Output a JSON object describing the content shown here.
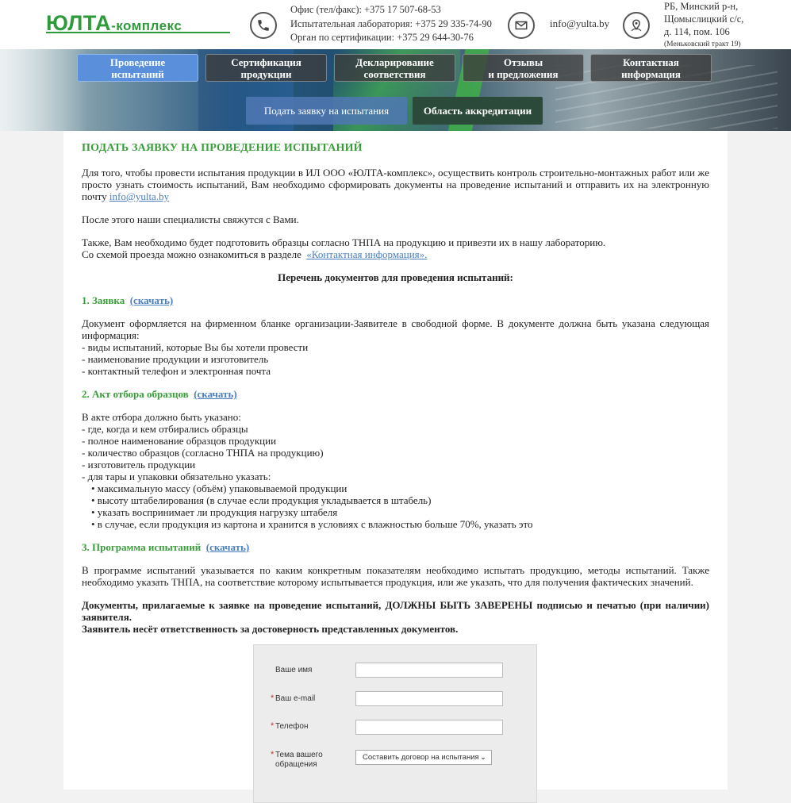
{
  "header": {
    "logo_main": "ЮЛТА",
    "logo_sub": "-комплекс",
    "phones": [
      "Офис (тел/факс): +375 17 507-68-53",
      "Испытательная лаборатория: +375 29 335-74-90",
      "Орган по сертификации: +375 29 644-30-76"
    ],
    "email": "info@yulta.by",
    "address": [
      "РБ, Минский р-н,",
      "Щомыслицкий с/с,",
      "д. 114, пом. 106"
    ],
    "address_note": "(Меньковский тракт 19)"
  },
  "nav": {
    "items": [
      {
        "label": "Проведение\nиспытаний",
        "active": true
      },
      {
        "label": "Сертификация\nпродукции",
        "active": false
      },
      {
        "label": "Декларирование\nсоответствия",
        "active": false
      },
      {
        "label": "Отзывы\nи предложения",
        "active": false
      },
      {
        "label": "Контактная\nинформация",
        "active": false
      }
    ],
    "sub_request": "Подать заявку на испытания",
    "sub_accreditation": "Область аккредитации"
  },
  "page": {
    "title": "ПОДАТЬ ЗАЯВКУ НА ПРОВЕДЕНИЕ ИСПЫТАНИЙ",
    "intro": "Для того, чтобы провести испытания продукции в ИЛ ООО «ЮЛТА-комплекс», осуществить контроль строительно-монтажных работ или же просто узнать стоимость испытаний, Вам необходимо сформировать документы на проведение испытаний и отправить их на электронную почту",
    "intro_email": "info@yulta.by",
    "after": "После этого наши специалисты свяжутся с Вами.",
    "samples": "Также, Вам необходимо будет подготовить образцы согласно ТНПА на продукцию и привезти их в нашу лабораторию.",
    "scheme": "Со схемой проезда можно ознакомиться в разделе",
    "scheme_link": "«Контактная информация».",
    "list_title": "Перечень документов для проведения испытаний:",
    "s1_title": "1. Заявка",
    "s1_link": "(скачать)",
    "s1_text": "Документ оформляется на фирменном бланке организации-Заявителе в свободной форме. В документе должна быть указана следующая информация:",
    "s1_items": [
      "- виды испытаний, которые Вы бы хотели провести",
      "- наименование продукции и изготовитель",
      "- контактный телефон и электронная почта"
    ],
    "s2_title": "2. Акт отбора образцов",
    "s2_link": "(скачать)",
    "s2_intro": "В акте отбора должно быть указано:",
    "s2_items": [
      "- где, когда и кем отбирались образцы",
      "- полное наименование образцов продукции",
      "- количество образцов (согласно ТНПА на продукцию)",
      "- изготовитель продукции",
      "- для тары и упаковки обязательно указать:"
    ],
    "s2_bullets": [
      "• максимальную массу (объём) упаковываемой продукции",
      "• высоту штабелирования (в случае если продукция укладывается в штабель)",
      "• указать воспринимает ли продукция нагрузку штабеля",
      "• в случае, если продукция из картона и хранится в условиях с влажностью больше 70%, указать это"
    ],
    "s3_title": "3. Программа испытаний",
    "s3_link": "(скачать)",
    "s3_text": "В программе испытаний указывается по каким конкретным показателям необходимо испытать продукцию, методы испытаний. Также необходимо указать ТНПА, на соответствие которому испытывается продукция, или же указать, что для получения фактических значений.",
    "warn1": "Документы, прилагаемые к заявке на проведение испытаний, ДОЛЖНЫ БЫТЬ ЗАВЕРЕНЫ подписью и печатью (при наличии) заявителя.",
    "warn2": "Заявитель несёт ответственность за достоверность представленных документов."
  },
  "form": {
    "name_label": "Ваше имя",
    "email_label": "Ваш e-mail",
    "phone_label": "Телефон",
    "topic_label": "Тема вашего обращения",
    "topic_value": "Составить договор на испытания",
    "required_mark": "*"
  }
}
